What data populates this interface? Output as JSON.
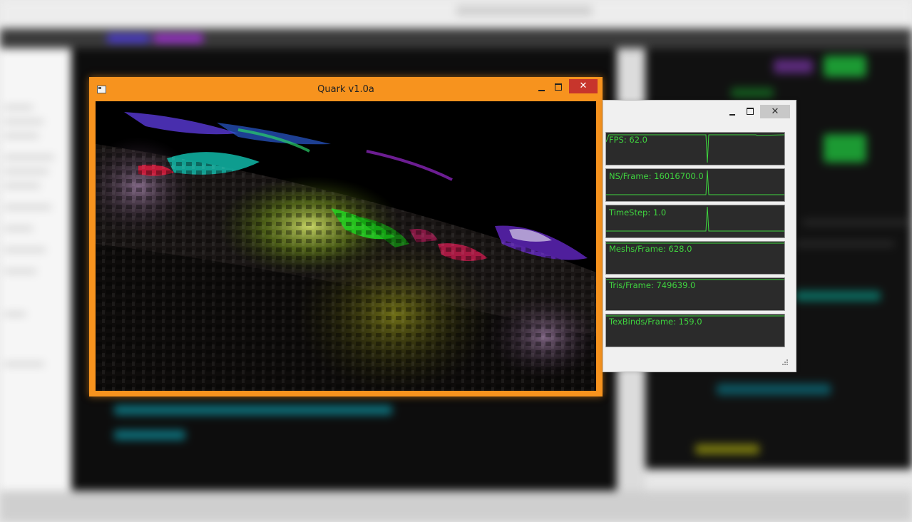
{
  "quark_window": {
    "title": "Quark v1.0a",
    "close_glyph": "✕",
    "accent": "#f7931e",
    "icon": "app-window-icon"
  },
  "stats_window": {
    "close_glyph": "✕",
    "graph_color": "#3fd43f",
    "graphs": [
      {
        "label": "FPS: 62.0"
      },
      {
        "label": "NS/Frame: 16016700.0"
      },
      {
        "label": "TimeStep: 1.0"
      },
      {
        "label": "Meshs/Frame: 628.0"
      },
      {
        "label": "Tris/Frame: 749639.0"
      },
      {
        "label": "TexBinds/Frame: 159.0"
      }
    ]
  }
}
